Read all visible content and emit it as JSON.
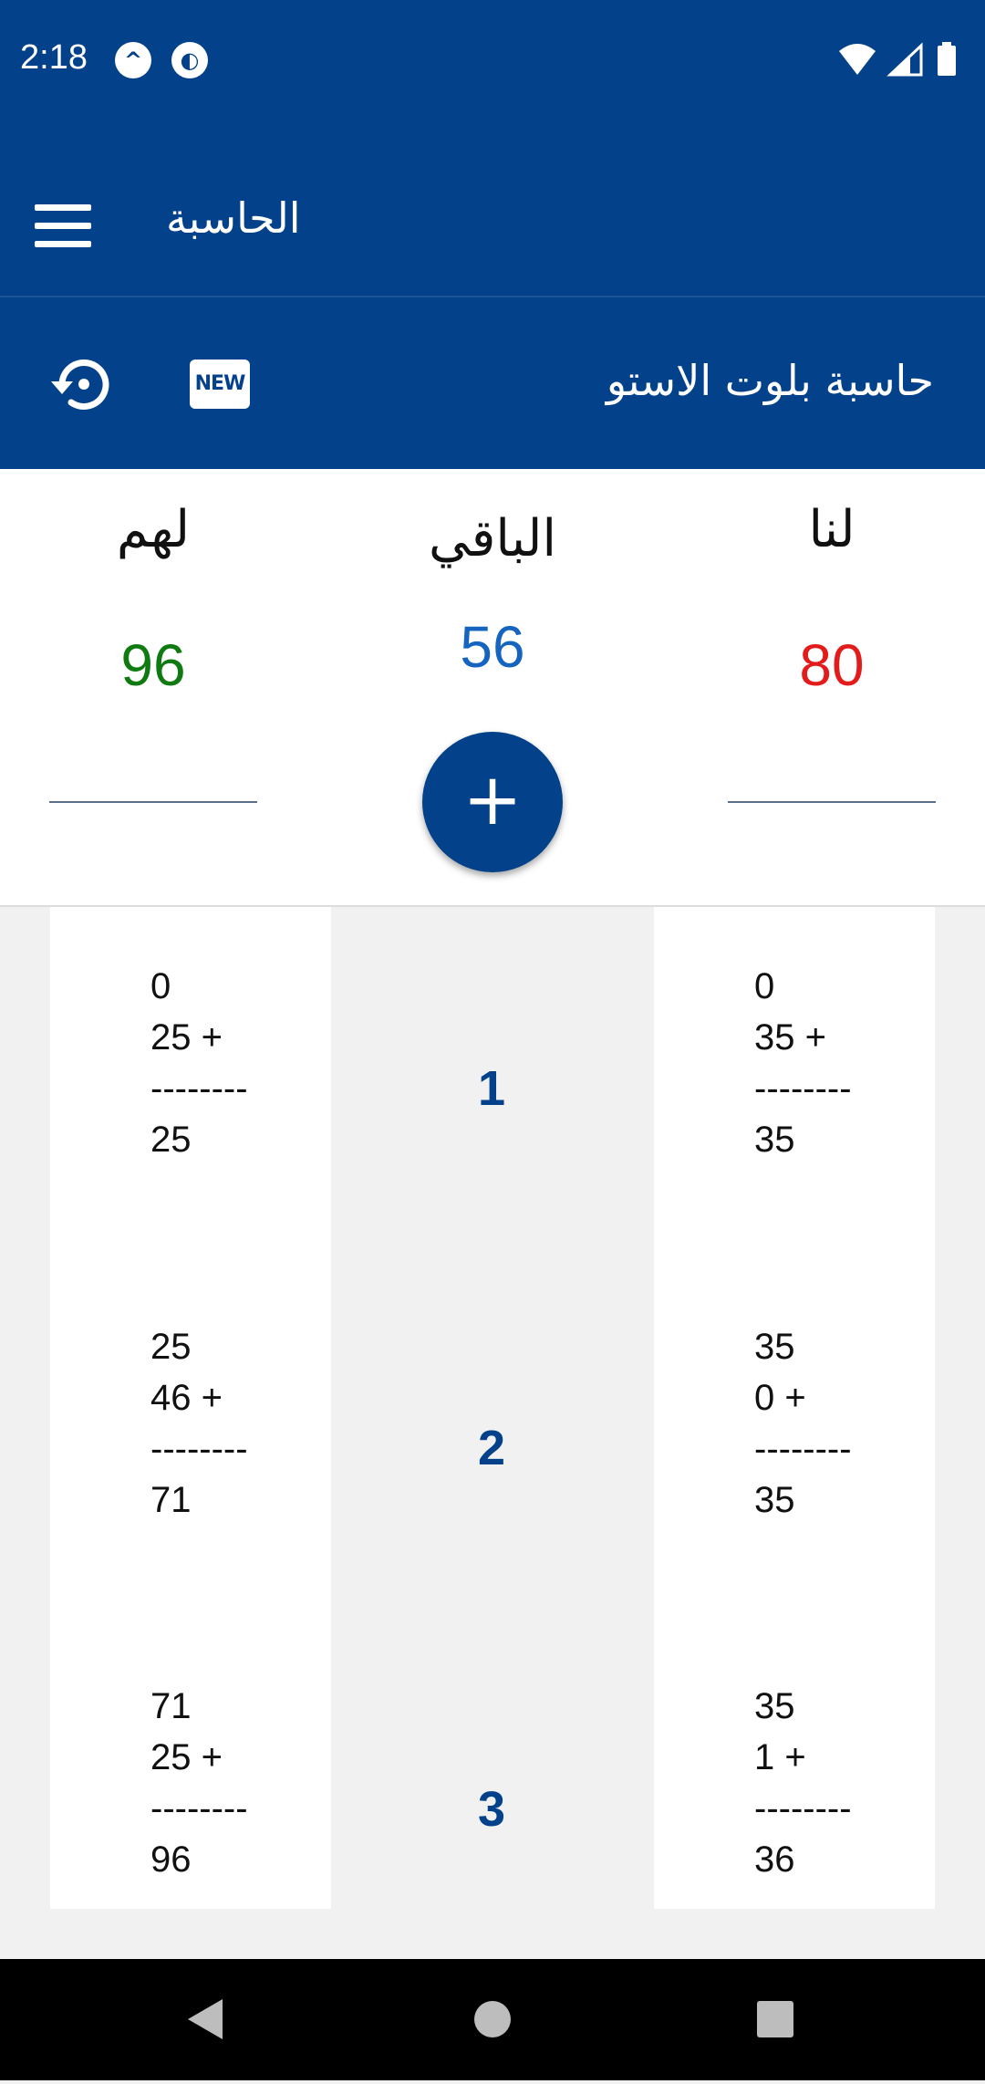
{
  "status_bar": {
    "time": "2:18"
  },
  "app_bar": {
    "title": "الحاسبة"
  },
  "sub_bar": {
    "title": "حاسبة بلوت الاستو",
    "new_badge": "NEW"
  },
  "scores": {
    "them_label": "لهم",
    "remaining_label": "الباقي",
    "us_label": "لنا",
    "them_score": "96",
    "remaining": "56",
    "us_score": "80",
    "add_label": "+"
  },
  "colors": {
    "primary": "#03428a",
    "them": "#0f7a10",
    "us": "#e31b1b",
    "remaining": "#1565c0"
  },
  "rounds": [
    {
      "number": "1",
      "them": {
        "prev": "0",
        "add": "25 +",
        "sep": "--------",
        "total": "25"
      },
      "us": {
        "prev": "0",
        "add": "35 +",
        "sep": "--------",
        "total": "35"
      }
    },
    {
      "number": "2",
      "them": {
        "prev": "25",
        "add": "46 +",
        "sep": "--------",
        "total": "71"
      },
      "us": {
        "prev": "35",
        "add": "0 +",
        "sep": "--------",
        "total": "35"
      }
    },
    {
      "number": "3",
      "them": {
        "prev": "71",
        "add": "25 +",
        "sep": "--------",
        "total": "96"
      },
      "us": {
        "prev": "35",
        "add": "1 +",
        "sep": "--------",
        "total": "36"
      }
    }
  ],
  "nav": {
    "back": "back-icon",
    "home": "home-icon",
    "recents": "recents-icon"
  }
}
